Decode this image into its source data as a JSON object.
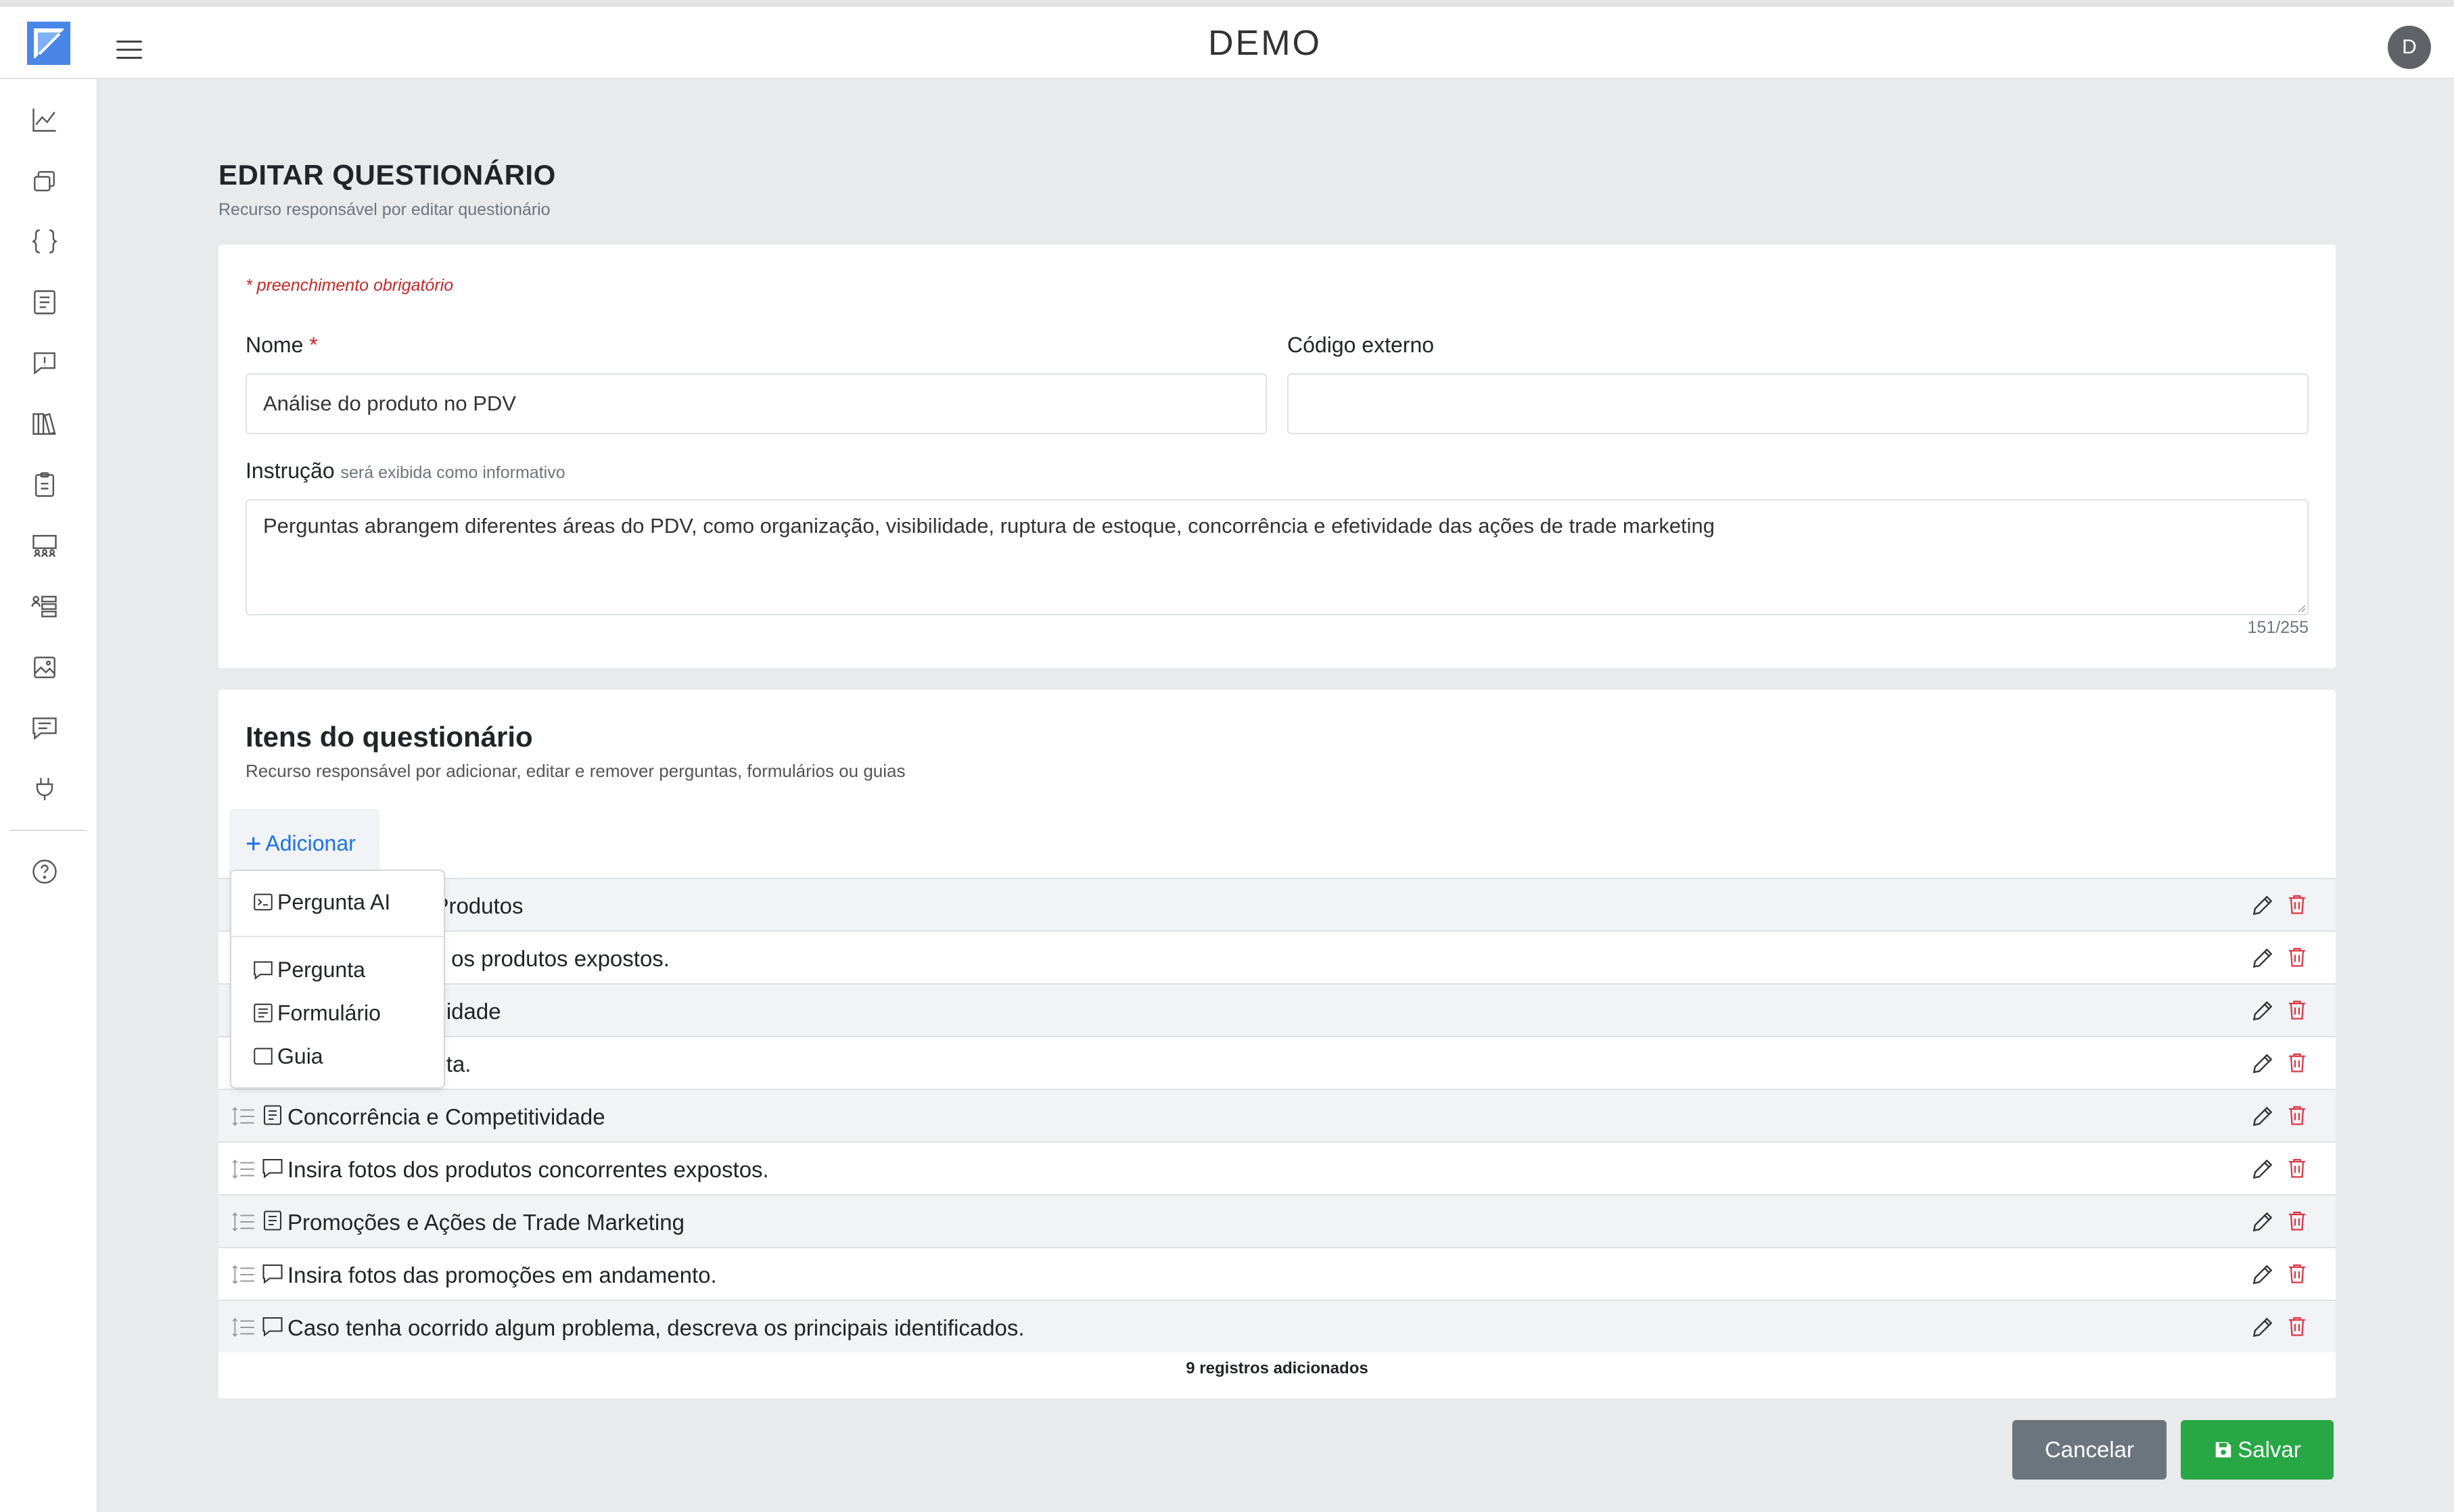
{
  "app": {
    "brand": "DEMO",
    "user_initial": "D"
  },
  "sidebar": {
    "icons": [
      "chart-line-icon",
      "copy-stack-icon",
      "braces-icon",
      "checklist-icon",
      "alert-message-icon",
      "library-icon",
      "clipboard-icon",
      "group-users-icon",
      "user-list-icon",
      "image-icon",
      "chat-icon",
      "plug-icon",
      "help-icon"
    ]
  },
  "page": {
    "title": "EDITAR QUESTIONÁRIO",
    "subtitle": "Recurso responsável por editar questionário"
  },
  "form": {
    "required_note": "* preenchimento obrigatório",
    "name_label": "Nome",
    "required_star": "*",
    "name_value": "Análise do produto no PDV",
    "external_code_label": "Código externo",
    "external_code_value": "",
    "instruction_label": "Instrução",
    "instruction_hint": "será exibida como informativo",
    "instruction_value": "Perguntas abrangem diferentes áreas do PDV, como organização, visibilidade, ruptura de estoque, concorrência e efetividade das ações de trade marketing",
    "counter": "151/255"
  },
  "items_section": {
    "title": "Itens do questionário",
    "subtitle": "Recurso responsável por adicionar, editar e remover perguntas, formulários ou guias",
    "add_button": "Adicionar",
    "add_symbol": "+",
    "rows": [
      {
        "icon": "form-icon",
        "text": "Disposição de Produtos"
      },
      {
        "icon": "question-icon",
        "text": "PDV mostrando os produtos expostos."
      },
      {
        "icon": "form-icon",
        "text": "que e Disponibilidade"
      },
      {
        "icon": "question-icon",
        "text": "rateleira completa."
      },
      {
        "icon": "form-icon",
        "text": "Concorrência e Competitividade"
      },
      {
        "icon": "question-icon",
        "text": "Insira fotos dos produtos concorrentes expostos."
      },
      {
        "icon": "form-icon",
        "text": "Promoções e Ações de Trade Marketing"
      },
      {
        "icon": "question-icon",
        "text": "Insira fotos das promoções em andamento."
      },
      {
        "icon": "question-icon",
        "text": "Caso tenha ocorrido algum problema, descreva os principais identificados."
      }
    ],
    "footer": "9 registros adicionados"
  },
  "dropdown": {
    "items": [
      {
        "icon": "terminal-icon",
        "label": "Pergunta AI"
      },
      {
        "icon": "question-icon",
        "label": "Pergunta"
      },
      {
        "icon": "form-icon",
        "label": "Formulário"
      },
      {
        "icon": "guide-icon",
        "label": "Guia"
      }
    ]
  },
  "actions": {
    "cancel": "Cancelar",
    "save": "Salvar"
  },
  "colors": {
    "accent": "#1a73e8",
    "danger": "#dc3545",
    "success": "#28a745",
    "secondary": "#6c757d"
  }
}
